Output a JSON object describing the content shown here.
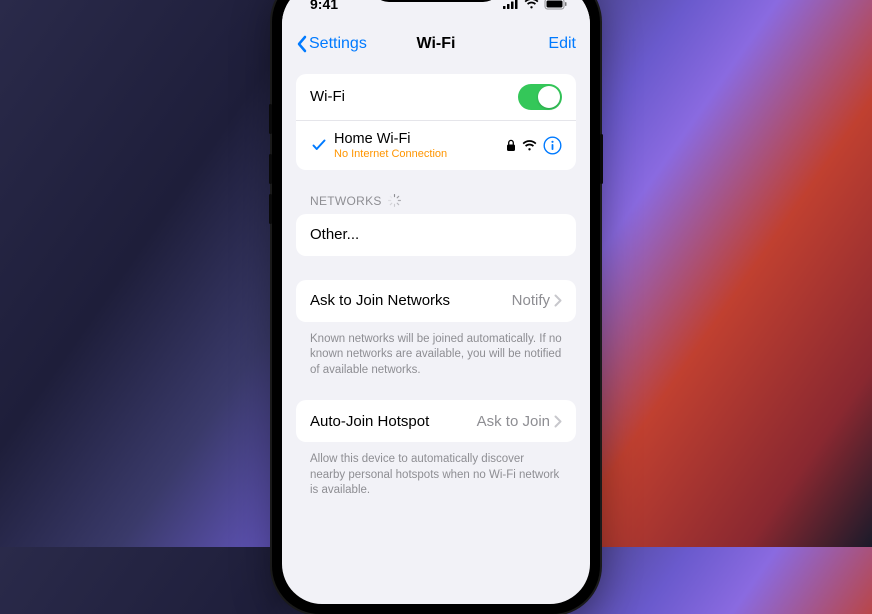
{
  "status": {
    "time": "9:41"
  },
  "nav": {
    "back": "Settings",
    "title": "Wi-Fi",
    "edit": "Edit"
  },
  "wifi": {
    "toggle_label": "Wi-Fi",
    "connected_name": "Home Wi-Fi",
    "connected_status": "No Internet Connection"
  },
  "networks": {
    "header": "NETWORKS",
    "other": "Other..."
  },
  "ask": {
    "label": "Ask to Join Networks",
    "value": "Notify",
    "footer": "Known networks will be joined automatically. If no known networks are available, you will be notified of available networks."
  },
  "hotspot": {
    "label": "Auto-Join Hotspot",
    "value": "Ask to Join",
    "footer": "Allow this device to automatically discover nearby personal hotspots when no Wi-Fi network is available."
  }
}
